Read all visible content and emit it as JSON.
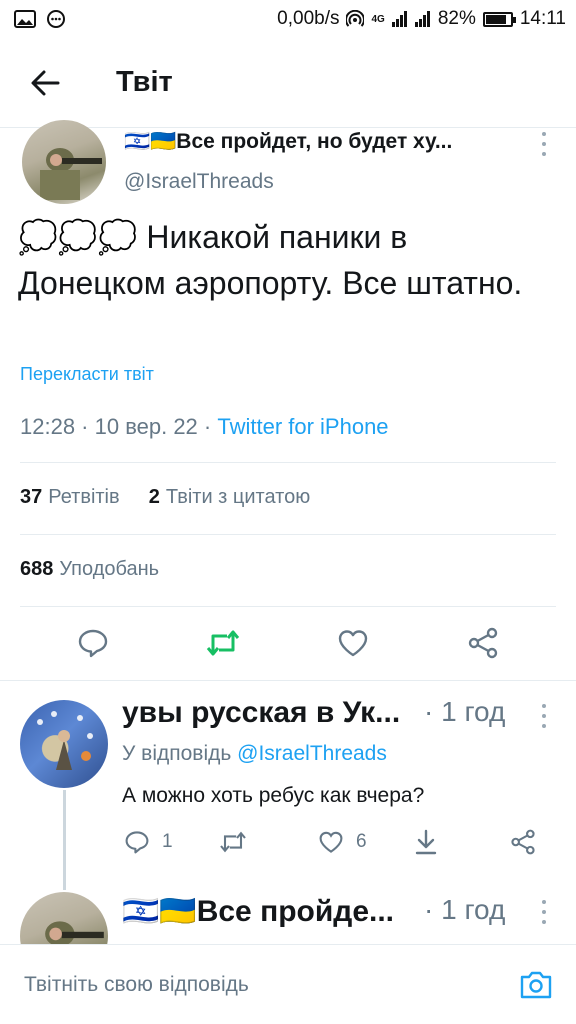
{
  "status_bar": {
    "net_speed": "0,00b/s",
    "network": "4G",
    "battery": "82%",
    "time": "14:11"
  },
  "header": {
    "title": "Твіт"
  },
  "tweet": {
    "author_name": "🇮🇱🇺🇦Все пройдет, но будет ху...",
    "handle": "@IsraelThreads",
    "text": "💭💭💭 Никакой паники в Донецком аэропорту. Все штатно.",
    "translate_label": "Перекласти твіт",
    "time_date": "12:28 · 10 вер. 22 · ",
    "source": "Twitter for iPhone",
    "retweets_count": "37",
    "retweets_label": "Ретвітів",
    "quotes_count": "2",
    "quotes_label": "Твіти з цитатою",
    "likes_count": "688",
    "likes_label": "Уподобань"
  },
  "reply": {
    "author_name": "увы русская в Ук...",
    "time": "· 1 год",
    "reply_to_label": "У відповідь ",
    "reply_to_handle": "@IsraelThreads",
    "text": "А можно хоть ребус как вчера?",
    "reply_count": "1",
    "like_count": "6"
  },
  "next_reply": {
    "author_name": "🇮🇱🇺🇦Все пройде...",
    "time": "· 1 год"
  },
  "composer": {
    "placeholder": "Твітніть свою відповідь"
  },
  "colors": {
    "accent": "#1da1f2",
    "retweet_green": "#17bf63",
    "muted": "#657786"
  }
}
